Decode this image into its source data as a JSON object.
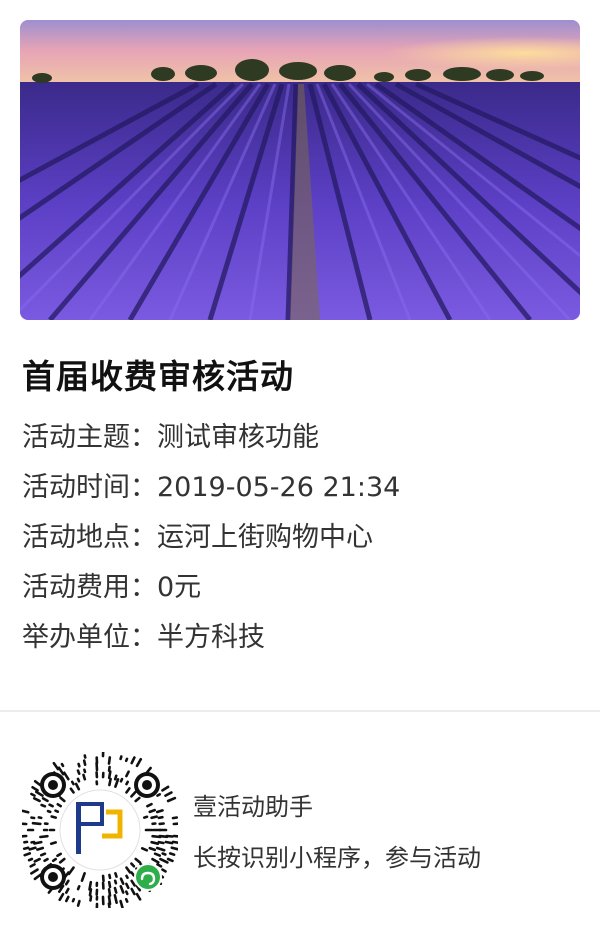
{
  "banner": {
    "alt_icon": "lavender-field-photo"
  },
  "event": {
    "title": "首届收费审核活动",
    "rows": [
      {
        "label": "活动主题：",
        "value": "测试审核功能"
      },
      {
        "label": "活动时间：",
        "value": "2019-05-26 21:34"
      },
      {
        "label": "活动地点：",
        "value": "运河上街购物中心"
      },
      {
        "label": "活动费用：",
        "value": "0元"
      },
      {
        "label": "举办单位：",
        "value": "半方科技"
      }
    ]
  },
  "footer": {
    "qr_icon": "mini-program-code-icon",
    "app_name": "壹活动助手",
    "hint": "长按识别小程序，参与活动"
  },
  "colors": {
    "title": "#111111",
    "text": "#333333",
    "divider": "#ececec",
    "lavender": "#5a3fc0",
    "wechat_green": "#2dae4b"
  }
}
